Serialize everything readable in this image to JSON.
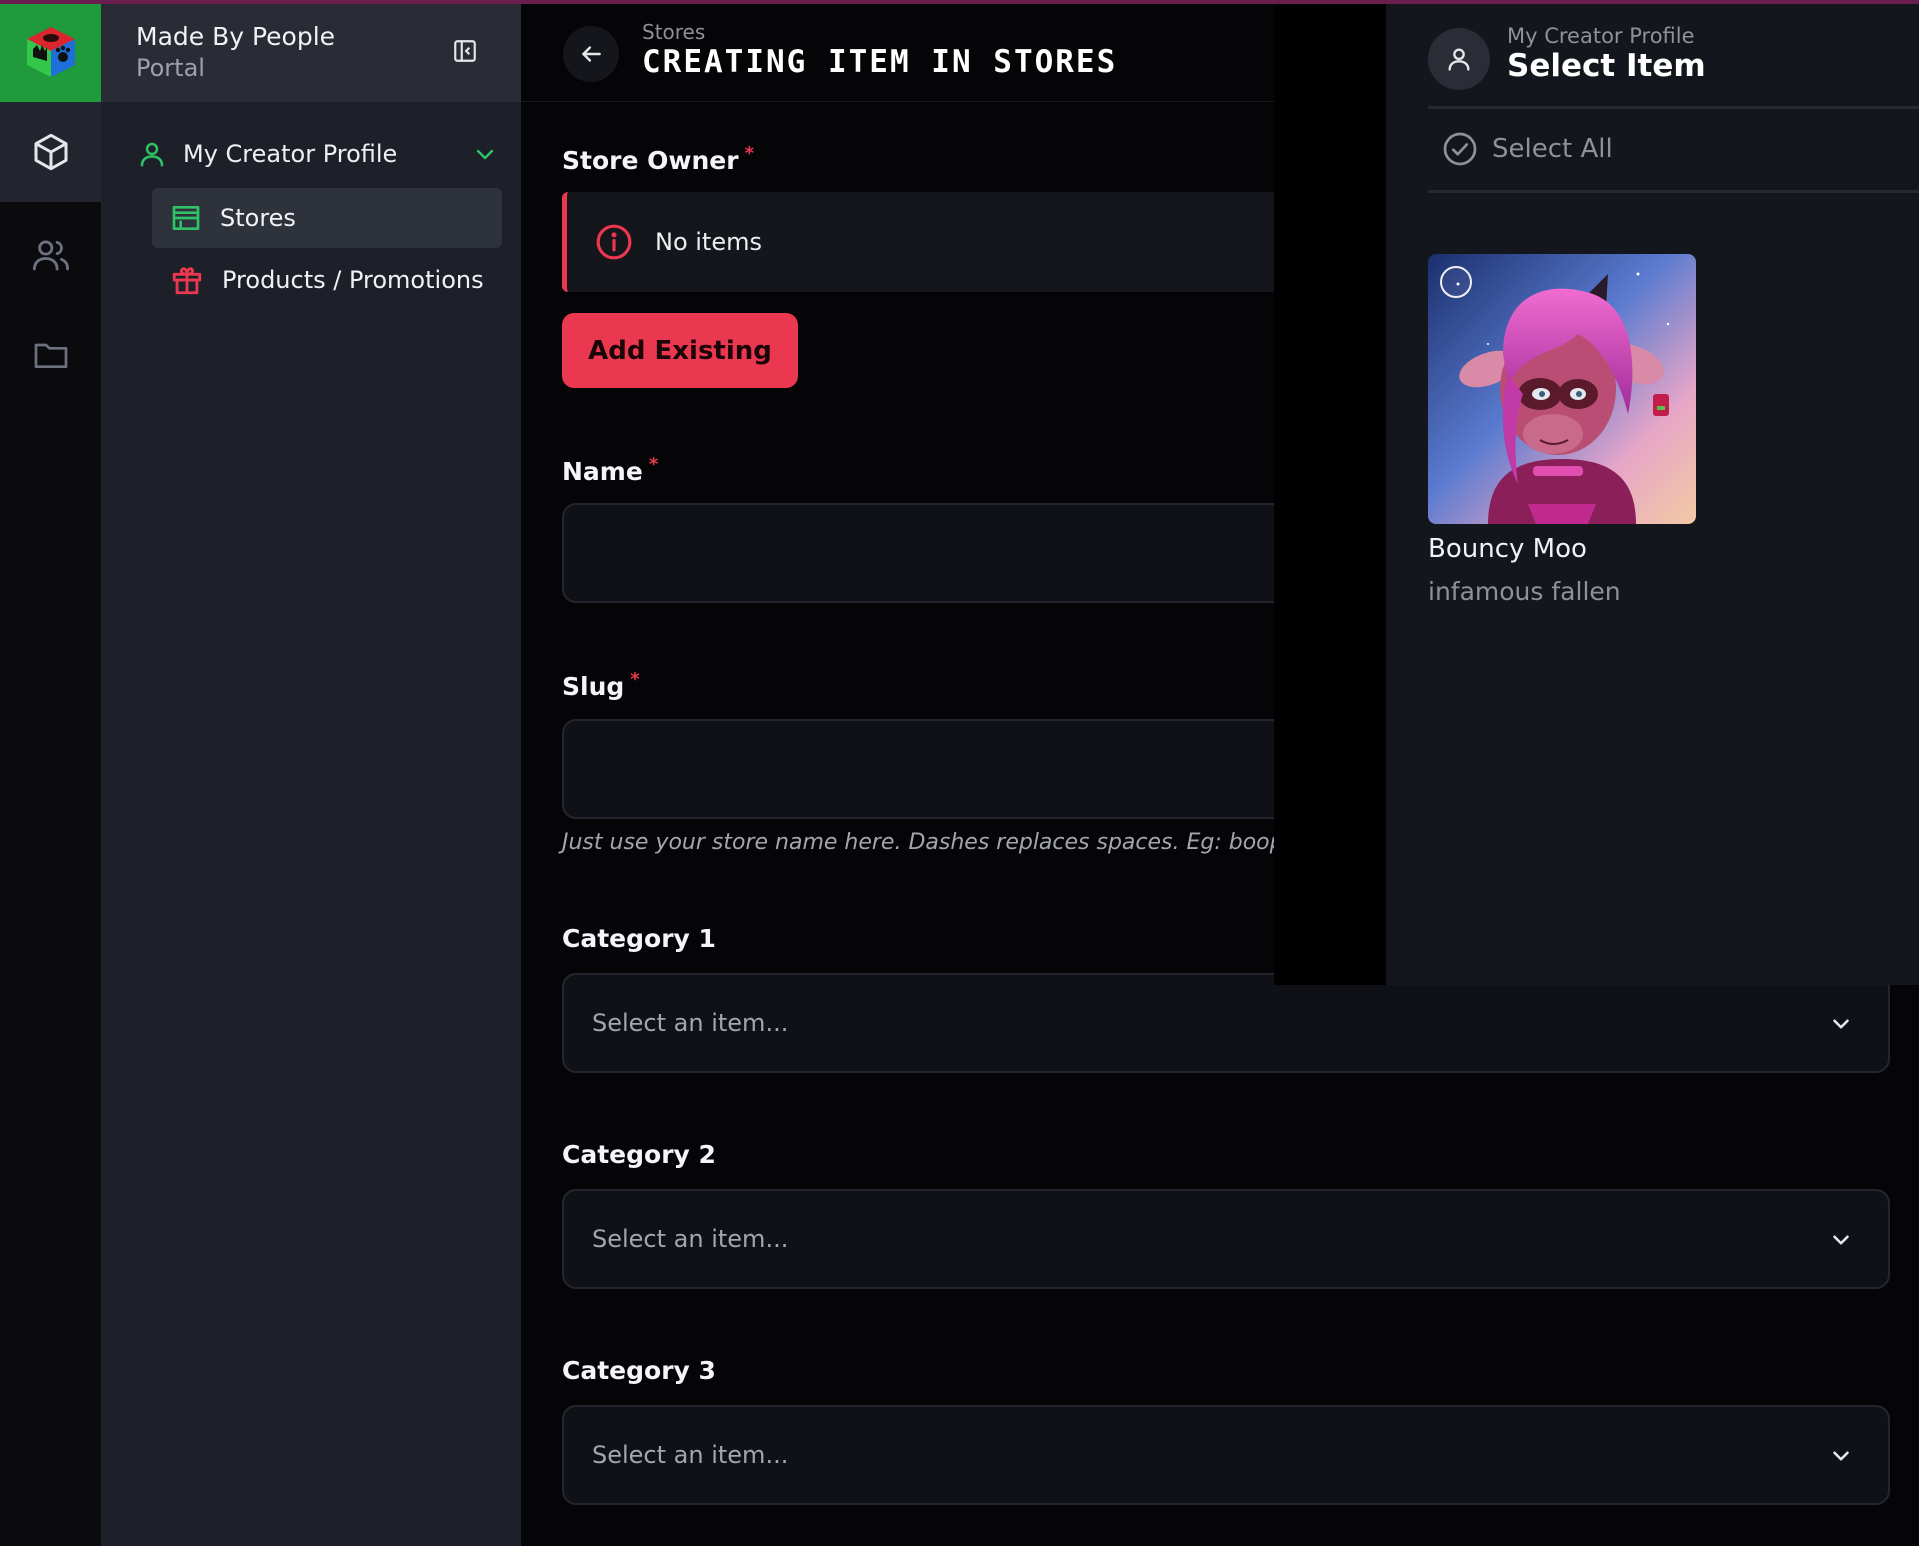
{
  "rail": {
    "logo_icon": "creator-cube-logo",
    "items": [
      {
        "icon": "cube-icon",
        "active": true
      },
      {
        "icon": "users-icon",
        "active": false
      },
      {
        "icon": "folder-icon",
        "active": false
      }
    ]
  },
  "sidebar": {
    "brand_title": "Made By People",
    "brand_subtitle": "Portal",
    "group_label": "My Creator Profile",
    "items": [
      {
        "label": "Stores",
        "icon": "store-icon",
        "active": true
      },
      {
        "label": "Products / Promotions",
        "icon": "gift-icon",
        "active": false
      }
    ]
  },
  "main": {
    "breadcrumb": "Stores",
    "title": "CREATING ITEM IN STORES",
    "store_owner_label": "Store Owner",
    "required_mark": "*",
    "alert_text": "No items",
    "add_existing_label": "Add Existing",
    "name_label": "Name",
    "name_value": "",
    "slug_label": "Slug",
    "slug_value": "",
    "slug_hint": "Just use your store name here. Dashes replaces spaces. Eg: boop c",
    "category1_label": "Category 1",
    "category2_label": "Category 2",
    "category3_label": "Category 3",
    "select_placeholder": "Select an item..."
  },
  "item_panel": {
    "breadcrumb": "My Creator Profile",
    "title": "Select Item",
    "select_all_label": "Select All",
    "items": [
      {
        "name": "Bouncy Moo",
        "subtitle": "infamous fallen"
      }
    ]
  },
  "colors": {
    "accent_red": "#e9384f",
    "accent_green": "#1f9b3b",
    "nav_green": "#2fc266"
  }
}
